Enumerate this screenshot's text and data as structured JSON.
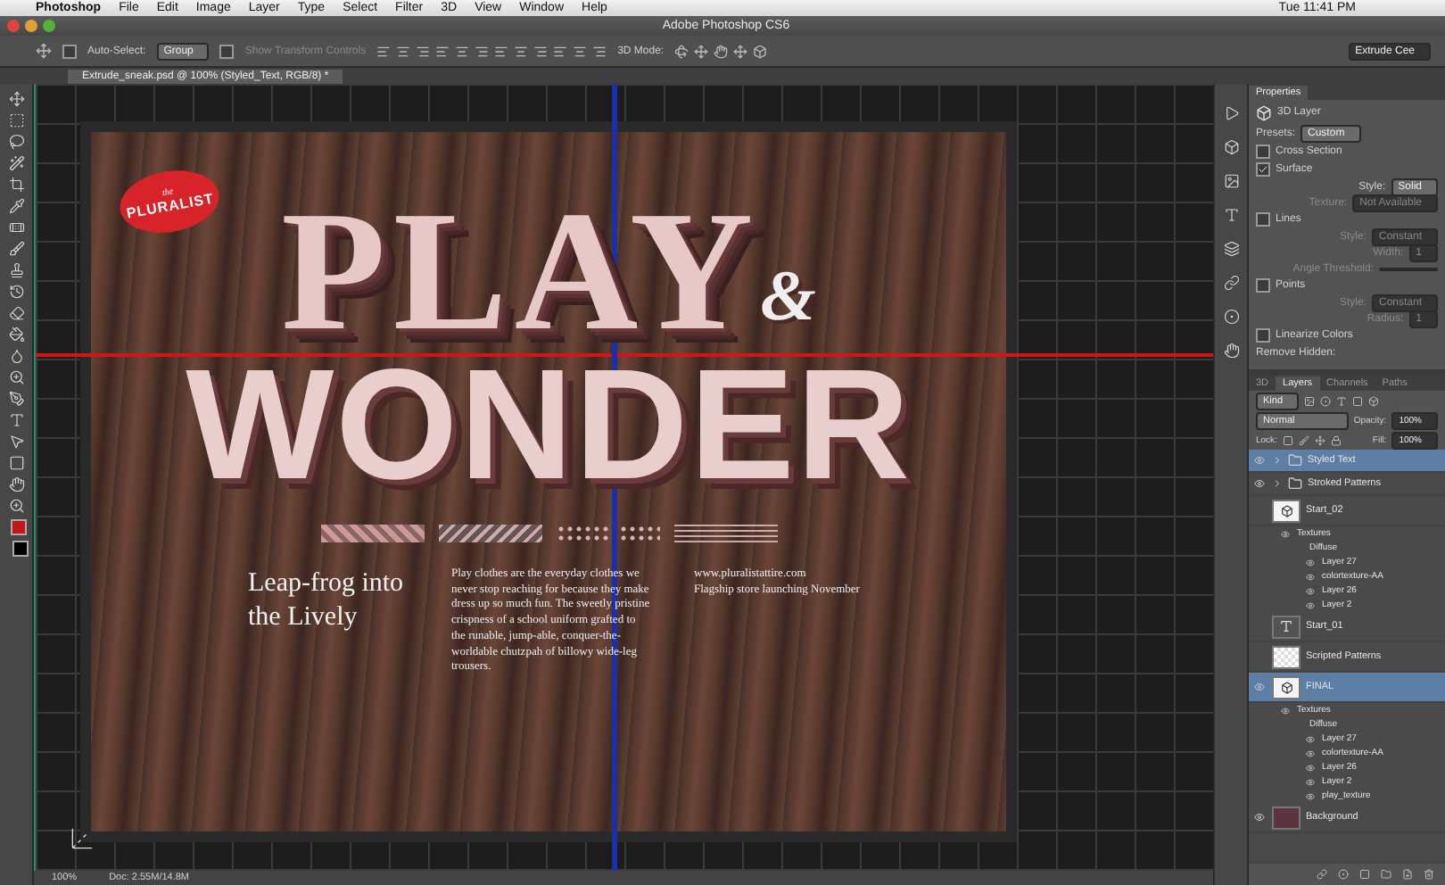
{
  "menubar": {
    "app": "Photoshop",
    "menus": [
      "File",
      "Edit",
      "Image",
      "Layer",
      "Type",
      "Select",
      "Filter",
      "3D",
      "View",
      "Window",
      "Help"
    ],
    "clock": "Tue 11:41 PM"
  },
  "window": {
    "title": "Adobe Photoshop CS6"
  },
  "options_bar": {
    "auto_select": {
      "label": "Auto-Select:",
      "checked": false,
      "value": "Group"
    },
    "show_transform": {
      "label": "Show Transform Controls",
      "checked": false
    },
    "mode_label": "3D Mode:",
    "workspace": "Extrude Cee"
  },
  "document_tab": {
    "title": "Extrude_sneak.psd @ 100% (Styled_Text, RGB/8) *"
  },
  "artwork": {
    "badge_small": "the",
    "badge": "PLURALIST",
    "headline_1": "PLAY",
    "ampersand": "&",
    "headline_2": "WONDER",
    "tagline": "Leap-frog into the Lively",
    "body": "Play clothes are the everyday clothes we never stop reaching for because they make dress up so much fun. The sweetly pristine crispness of a school uniform grafted to the runable, jump-able, conquer-the-worldable chutzpah of billowy wide-leg trousers.",
    "url": "www.pluralistattire.com",
    "note": "Flagship store launching November"
  },
  "properties": {
    "tab": "Properties",
    "layer_type": "3D Layer",
    "presets_label": "Presets:",
    "presets_value": "Custom",
    "options": [
      {
        "label": "Cross Section",
        "checked": false
      },
      {
        "label": "Surface",
        "checked": true,
        "fields": [
          {
            "label": "Style:",
            "value": "Solid",
            "disabled": false
          },
          {
            "label": "Texture:",
            "value": "Not Available",
            "disabled": true
          }
        ]
      },
      {
        "label": "Lines",
        "checked": false,
        "fields": [
          {
            "label": "Style:",
            "value": "Constant",
            "disabled": true
          },
          {
            "label": "Width:",
            "value": "1",
            "disabled": true
          },
          {
            "label": "Angle Threshold:",
            "disabled": true
          }
        ]
      },
      {
        "label": "Points",
        "checked": false,
        "fields": [
          {
            "label": "Style:",
            "value": "Constant",
            "disabled": true
          },
          {
            "label": "Radius:",
            "value": "1",
            "disabled": true
          }
        ]
      },
      {
        "label": "Linearize Colors",
        "checked": false
      }
    ],
    "remove_hidden": "Remove Hidden:"
  },
  "layers": {
    "tabs": [
      {
        "label": "3D",
        "selected": false
      },
      {
        "label": "Layers",
        "selected": true
      },
      {
        "label": "Channels",
        "selected": false
      },
      {
        "label": "Paths",
        "selected": false
      }
    ],
    "filter": "Kind",
    "blend": "Normal",
    "opacity_label": "Opacity:",
    "opacity": "100%",
    "lock_label": "Lock:",
    "fill_label": "Fill:",
    "fill": "100%",
    "items": [
      {
        "name": "Styled Text",
        "kind": "group",
        "visible": true,
        "selected": true
      },
      {
        "name": "Stroked Patterns",
        "kind": "group",
        "visible": true,
        "selected": false
      },
      {
        "name": "Start_02",
        "kind": "model",
        "visible": false,
        "selected": false,
        "children": [
          {
            "name": "Textures",
            "visible": true,
            "children": [
              {
                "name": "Diffuse",
                "visible": false,
                "children": [
                  {
                    "name": "Layer 27",
                    "visible": true
                  },
                  {
                    "name": "colortexture-AA",
                    "visible": true
                  },
                  {
                    "name": "Layer 26",
                    "visible": true
                  },
                  {
                    "name": "Layer 2",
                    "visible": true
                  }
                ]
              }
            ]
          }
        ]
      },
      {
        "name": "Start_01",
        "kind": "type",
        "visible": false,
        "selected": false
      },
      {
        "name": "Scripted Patterns",
        "kind": "pixel",
        "visible": false,
        "selected": false
      },
      {
        "name": "FINAL",
        "kind": "model",
        "visible": true,
        "selected": true,
        "children": [
          {
            "name": "Textures",
            "visible": true,
            "children": [
              {
                "name": "Diffuse",
                "visible": false,
                "children": [
                  {
                    "name": "Layer 27",
                    "visible": true
                  },
                  {
                    "name": "colortexture-AA",
                    "visible": true
                  },
                  {
                    "name": "Layer 26",
                    "visible": true
                  },
                  {
                    "name": "Layer 2",
                    "visible": true
                  },
                  {
                    "name": "play_texture",
                    "visible": true
                  }
                ]
              }
            ]
          }
        ]
      },
      {
        "name": "Background",
        "kind": "photo",
        "visible": true,
        "selected": false
      }
    ]
  },
  "status_bar": {
    "zoom": "100%",
    "doc": "Doc: 2.55M/14.8M"
  }
}
